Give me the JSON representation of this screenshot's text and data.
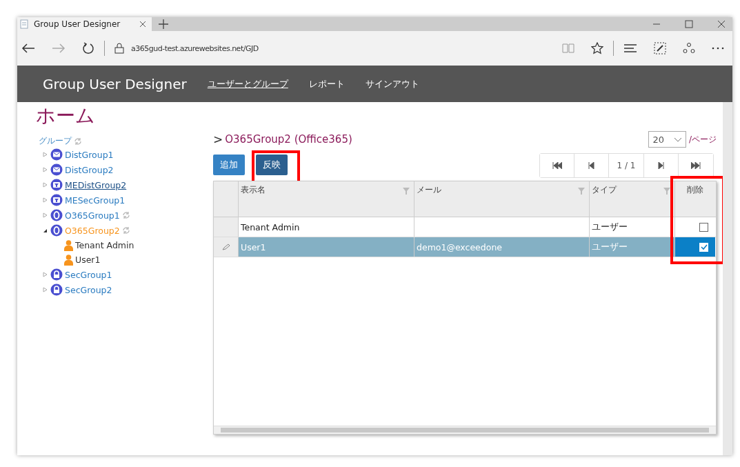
{
  "browser": {
    "tab_title": "Group User Designer",
    "url": "a365gud-test.azurewebsites.net/GJD"
  },
  "app": {
    "title": "Group User Designer",
    "nav": [
      {
        "label": "ユーザーとグループ",
        "selected": true
      },
      {
        "label": "レポート",
        "selected": false
      },
      {
        "label": "サインアウト",
        "selected": false
      }
    ]
  },
  "sidebar": {
    "heading": "ホーム",
    "root": {
      "label": "グループ",
      "sync": true
    },
    "groups": [
      {
        "label": "DistGroup1",
        "kind": "mail",
        "expanded": false,
        "selected": false,
        "hovered": false,
        "sync": false
      },
      {
        "label": "DistGroup2",
        "kind": "mail",
        "expanded": false,
        "selected": false,
        "hovered": false,
        "sync": false
      },
      {
        "label": "MEDistGroup2",
        "kind": "filter",
        "expanded": false,
        "selected": false,
        "hovered": true,
        "sync": false
      },
      {
        "label": "MESecGroup1",
        "kind": "filter",
        "expanded": false,
        "selected": false,
        "hovered": false,
        "sync": false
      },
      {
        "label": "O365Group1",
        "kind": "o365",
        "expanded": false,
        "selected": false,
        "hovered": false,
        "sync": true
      },
      {
        "label": "O365Group2",
        "kind": "o365",
        "expanded": true,
        "selected": true,
        "hovered": false,
        "sync": true,
        "children": [
          {
            "label": "Tenant Admin"
          },
          {
            "label": "User1"
          }
        ]
      },
      {
        "label": "SecGroup1",
        "kind": "lock",
        "expanded": false,
        "selected": false,
        "hovered": false,
        "sync": false
      },
      {
        "label": "SecGroup2",
        "kind": "lock",
        "expanded": false,
        "selected": false,
        "hovered": false,
        "sync": false
      }
    ]
  },
  "main": {
    "breadcrumb_mark": ">",
    "title": "O365Group2 (Office365)",
    "page_size": "20",
    "per_page": "/ページ",
    "buttons": [
      {
        "label": "追加",
        "highlighted": false
      },
      {
        "label": "反映",
        "highlighted": true
      }
    ],
    "pager": "1 / 1",
    "columns": [
      {
        "label": "表示名",
        "filter": true,
        "highlighted": false
      },
      {
        "label": "メール",
        "filter": true,
        "highlighted": false
      },
      {
        "label": "タイプ",
        "filter": true,
        "highlighted": false
      },
      {
        "label": "削除",
        "filter": false,
        "highlighted": true
      }
    ],
    "rows": [
      {
        "name": "Tenant Admin",
        "type": "ユーザー",
        "delete": false,
        "selected": false,
        "editing": false
      },
      {
        "name": "User1",
        "mail": "demo1@exceedone",
        "type": "ユーザー",
        "delete": true,
        "selected": true,
        "editing": true
      }
    ]
  }
}
